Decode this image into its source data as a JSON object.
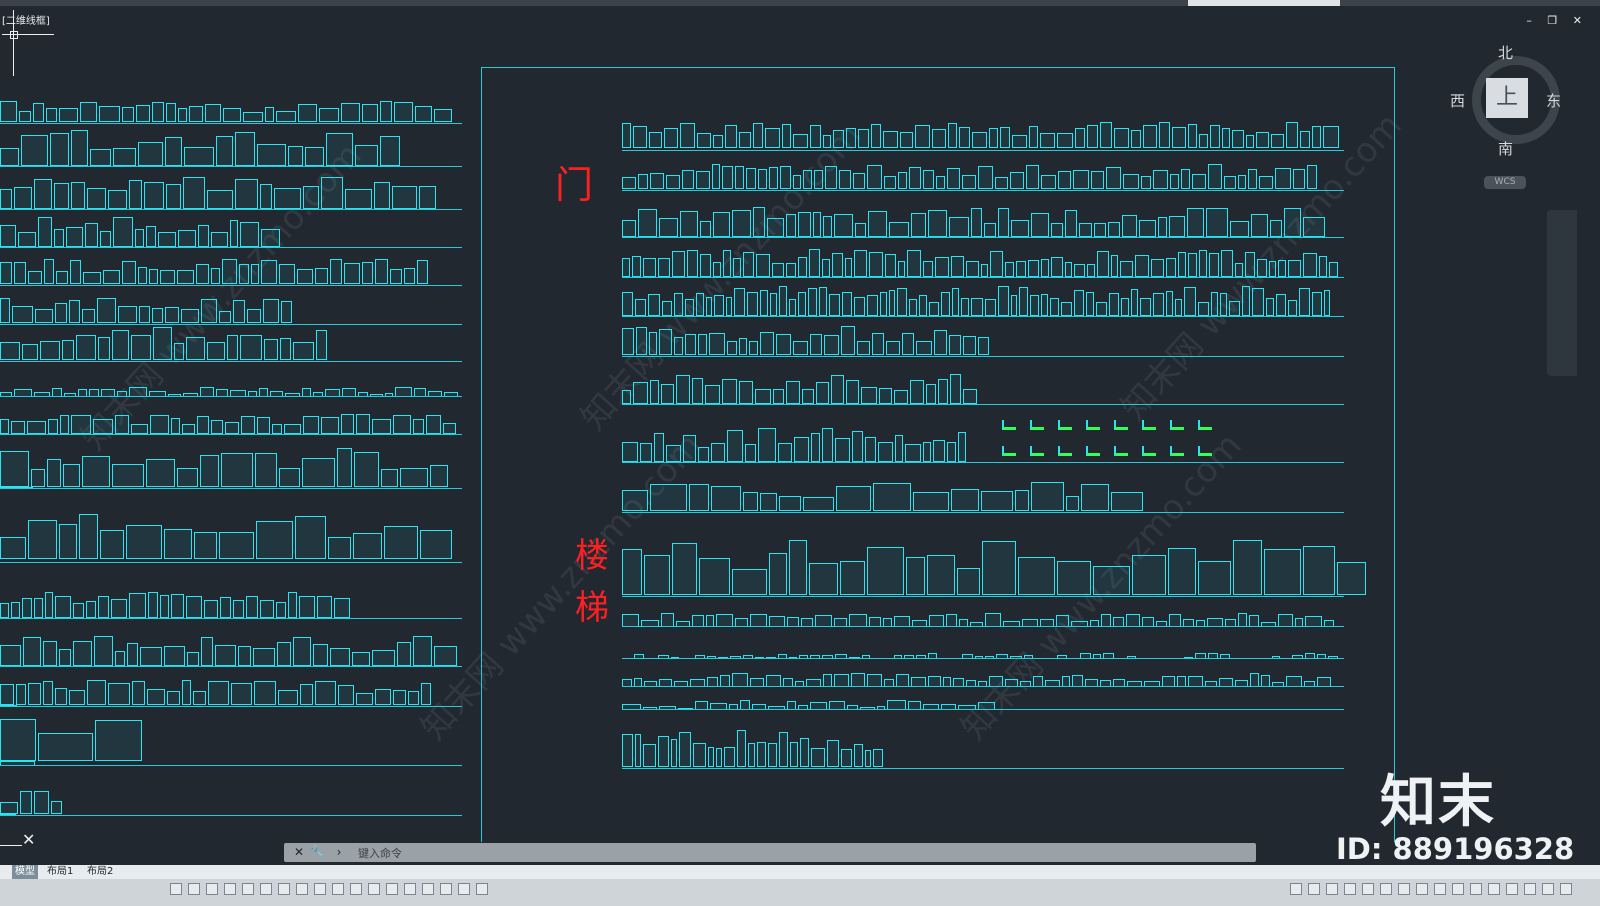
{
  "viewport": {
    "label": "[二维线框]"
  },
  "window_controls": "– ❐ ✕",
  "view_cube": {
    "north": "北",
    "south": "南",
    "west": "西",
    "east": "东",
    "face": "上",
    "wcs_label": "WCS"
  },
  "drawing_labels": {
    "door": "门",
    "stairs_top": "楼",
    "stairs_bottom": "梯"
  },
  "watermark": {
    "brand": "知末",
    "id": "ID: 889196328",
    "repeat_text": "知末网 www.znzmo.com"
  },
  "command_line": {
    "close_icon": "✕",
    "wrench_icon": "🔧",
    "prompt_placeholder": "键入命令"
  },
  "layout_tabs": [
    {
      "label": "模型",
      "active": true
    },
    {
      "label": "布局1",
      "active": false
    },
    {
      "label": "布局2",
      "active": false
    }
  ],
  "colors": {
    "background": "#212830",
    "cad_cyan": "#27e6f2",
    "label_red": "#ff2121",
    "accent_green": "#35ff5a"
  }
}
